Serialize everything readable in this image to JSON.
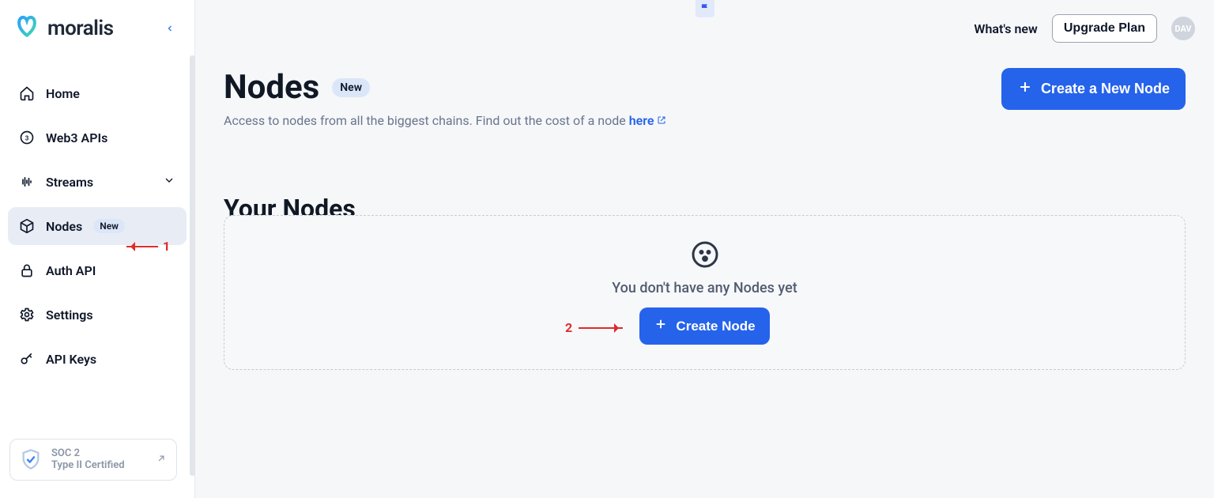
{
  "brand": {
    "name": "moralis"
  },
  "topbar": {
    "whats_new": "What's new",
    "upgrade": "Upgrade Plan",
    "avatar_initials": "DAV"
  },
  "sidebar": {
    "items": [
      {
        "label": "Home"
      },
      {
        "label": "Web3 APIs"
      },
      {
        "label": "Streams"
      },
      {
        "label": "Nodes",
        "badge": "New"
      },
      {
        "label": "Auth API"
      },
      {
        "label": "Settings"
      },
      {
        "label": "API Keys"
      }
    ],
    "soc": {
      "line1": "SOC 2",
      "line2": "Type II Certified"
    }
  },
  "page": {
    "title": "Nodes",
    "title_badge": "New",
    "subtitle_prefix": "Access to nodes from all the biggest chains. Find out the cost of a node ",
    "subtitle_link": "here",
    "create_button": "Create a New Node"
  },
  "section": {
    "title": "Your Nodes",
    "empty_message": "You don't have any Nodes yet",
    "empty_button": "Create Node"
  },
  "annotations": {
    "step1": "1",
    "step2": "2"
  }
}
